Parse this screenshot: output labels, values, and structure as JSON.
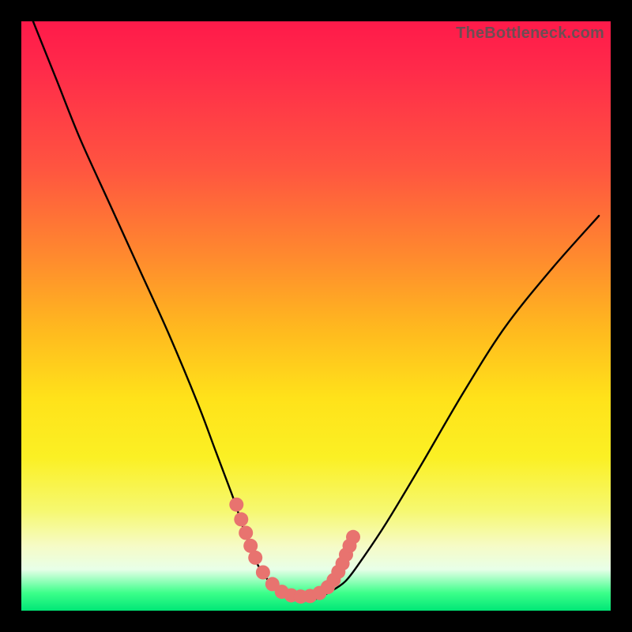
{
  "watermark": "TheBottleneck.com",
  "chart_data": {
    "type": "line",
    "title": "",
    "xlabel": "",
    "ylabel": "",
    "xlim": [
      0,
      100
    ],
    "ylim": [
      0,
      100
    ],
    "series": [
      {
        "name": "bottleneck-curve",
        "x": [
          2,
          6,
          10,
          15,
          20,
          25,
          30,
          33,
          36,
          38,
          40,
          42,
          44,
          46,
          48,
          50,
          52,
          55,
          58,
          62,
          68,
          75,
          82,
          90,
          98
        ],
        "values": [
          100,
          90,
          80,
          69,
          58,
          47,
          35,
          27,
          19,
          13,
          8,
          5,
          3,
          2,
          2,
          2,
          3,
          5,
          9,
          15,
          25,
          37,
          48,
          58,
          67
        ]
      }
    ],
    "markers": {
      "name": "highlight-dots",
      "color": "#e8736f",
      "x": [
        36.5,
        37.3,
        38.1,
        38.9,
        39.7,
        41.0,
        42.6,
        44.2,
        45.8,
        47.4,
        49.0,
        50.6,
        52.0,
        53.0,
        53.8,
        54.5,
        55.1,
        55.7,
        56.3
      ],
      "values": [
        18.0,
        15.5,
        13.2,
        11.0,
        9.0,
        6.5,
        4.5,
        3.2,
        2.6,
        2.4,
        2.5,
        3.0,
        4.0,
        5.2,
        6.6,
        8.0,
        9.5,
        11.0,
        12.5
      ]
    }
  }
}
